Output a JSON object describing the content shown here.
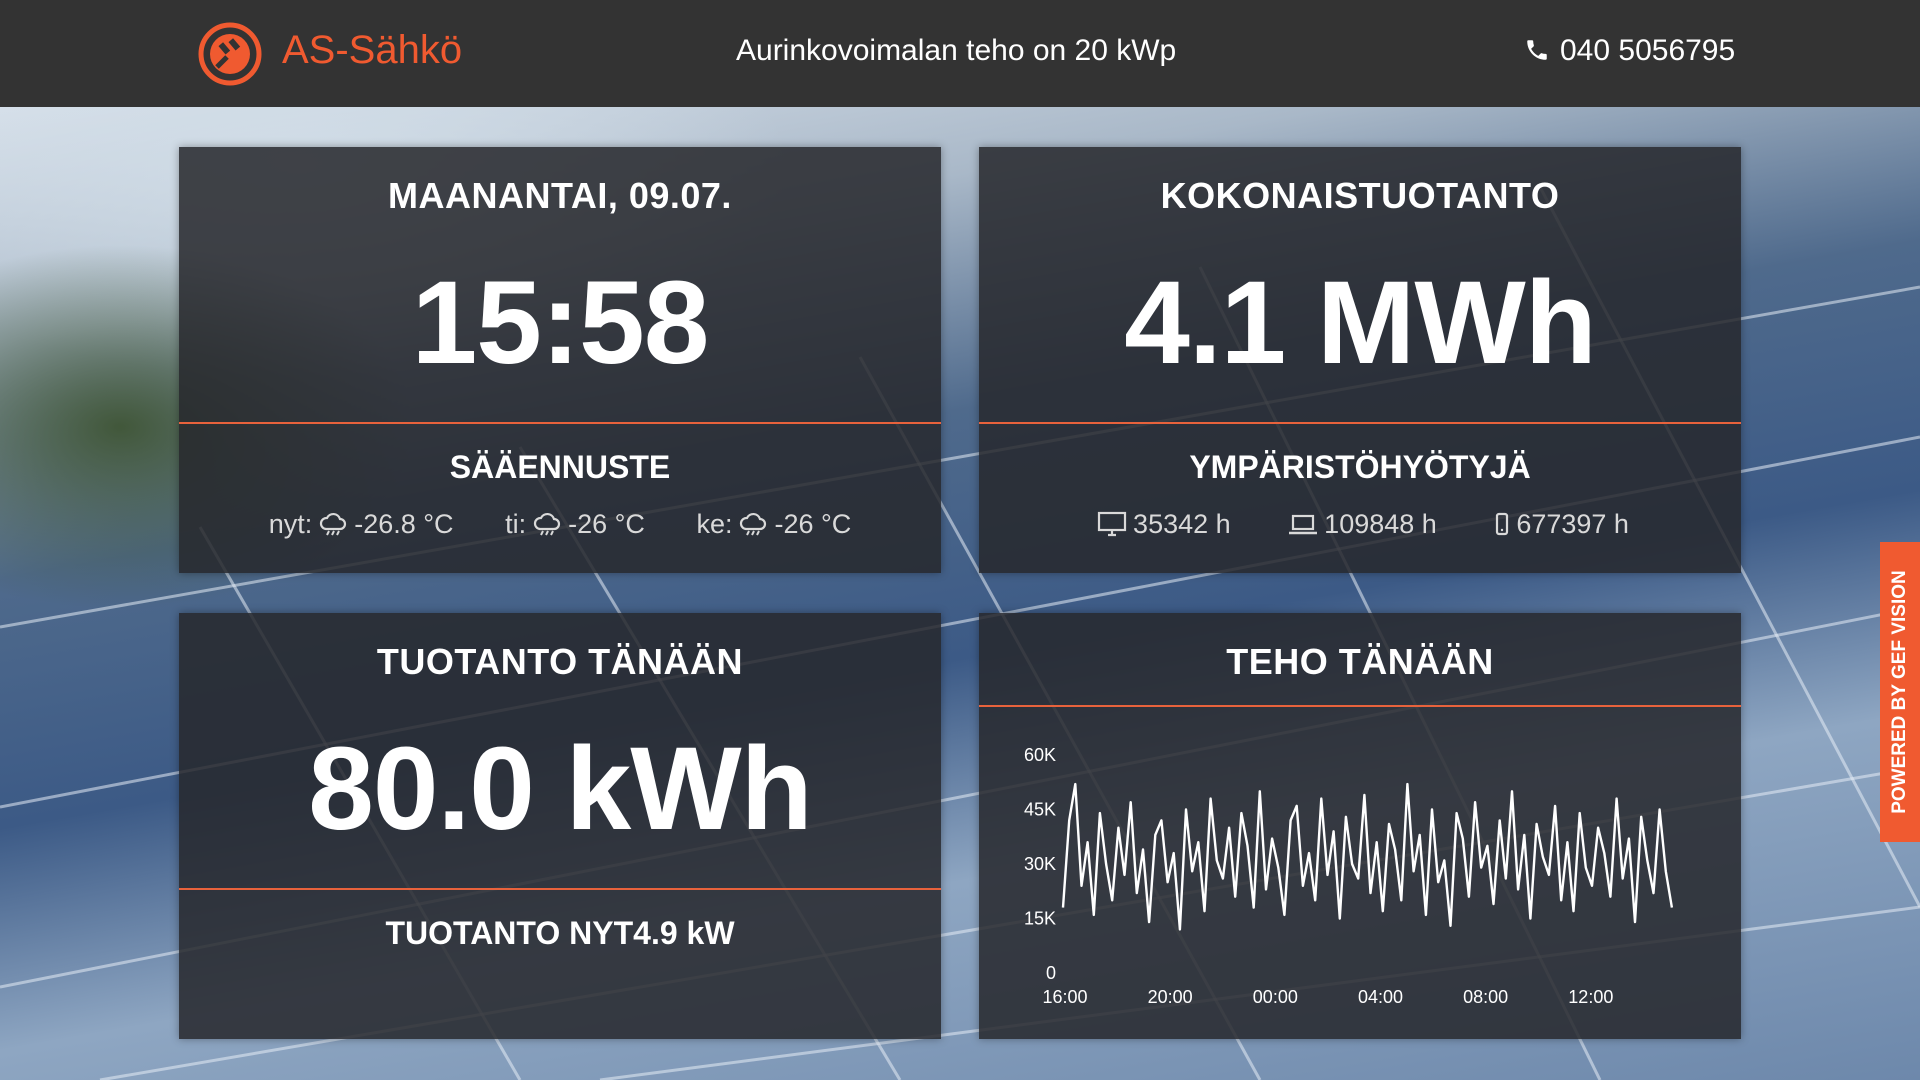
{
  "header": {
    "brand": "AS-Sähkö",
    "tagline": "Aurinkovoimalan teho on 20 kWp",
    "phone": "040 5056795",
    "accent_color": "#f05a30"
  },
  "clock_card": {
    "date_label": "MAANANTAI, 09.07.",
    "time": "15:58",
    "forecast_title": "SÄÄENNUSTE",
    "forecast": [
      {
        "label": "nyt:",
        "icon": "cloud-rain-icon",
        "value": "-26.8 °C"
      },
      {
        "label": "ti:",
        "icon": "cloud-rain-icon",
        "value": "-26 °C"
      },
      {
        "label": "ke:",
        "icon": "cloud-rain-icon",
        "value": "-26 °C"
      }
    ]
  },
  "total_card": {
    "title": "KOKONAISTUOTANTO",
    "value": "4.1 MWh",
    "benefits_title": "YMPÄRISTÖHYÖTYJÄ",
    "benefits": [
      {
        "icon": "monitor-icon",
        "value": "35342 h"
      },
      {
        "icon": "laptop-icon",
        "value": "109848 h"
      },
      {
        "icon": "phone-icon",
        "value": "677397 h"
      }
    ]
  },
  "today_card": {
    "title": "TUOTANTO TÄNÄÄN",
    "value": "80.0 kWh",
    "now_label": "TUOTANTO NYT4.9 kW"
  },
  "side_tab": {
    "label": "POWERED BY GEF VISION"
  },
  "chart_data": {
    "type": "line",
    "title": "TEHO TÄNÄÄN",
    "xlabel": "",
    "ylabel": "",
    "ylim": [
      0,
      60000
    ],
    "yticks": [
      {
        "value": 0,
        "label": "0"
      },
      {
        "value": 15000,
        "label": "15K"
      },
      {
        "value": 30000,
        "label": "30K"
      },
      {
        "value": 45000,
        "label": "45K"
      },
      {
        "value": 60000,
        "label": "60K"
      }
    ],
    "xticks": [
      {
        "value": 0,
        "label": "16:00"
      },
      {
        "value": 4,
        "label": "20:00"
      },
      {
        "value": 8,
        "label": "00:00"
      },
      {
        "value": 12,
        "label": "04:00"
      },
      {
        "value": 16,
        "label": "08:00"
      },
      {
        "value": 20,
        "label": "12:00"
      }
    ],
    "xlim": [
      0,
      24
    ],
    "grid": false,
    "line_color": "#ffffff",
    "values": [
      18000,
      42000,
      52000,
      24000,
      36000,
      16000,
      44000,
      30000,
      20000,
      40000,
      27000,
      47000,
      22000,
      34000,
      14000,
      38000,
      42000,
      25000,
      33000,
      12000,
      45000,
      28000,
      36000,
      17000,
      48000,
      31000,
      26000,
      40000,
      21000,
      44000,
      35000,
      18000,
      50000,
      23000,
      37000,
      29000,
      16000,
      42000,
      46000,
      24000,
      33000,
      20000,
      48000,
      27000,
      39000,
      15000,
      43000,
      30000,
      26000,
      49000,
      22000,
      36000,
      17000,
      41000,
      34000,
      20000,
      52000,
      28000,
      38000,
      16000,
      45000,
      25000,
      31000,
      13000,
      44000,
      37000,
      21000,
      47000,
      29000,
      35000,
      19000,
      42000,
      26000,
      50000,
      23000,
      38000,
      15000,
      41000,
      32000,
      27000,
      46000,
      20000,
      36000,
      17000,
      44000,
      29000,
      24000,
      40000,
      33000,
      21000,
      48000,
      26000,
      37000,
      14000,
      43000,
      31000,
      22000,
      45000,
      28000,
      18000
    ]
  }
}
